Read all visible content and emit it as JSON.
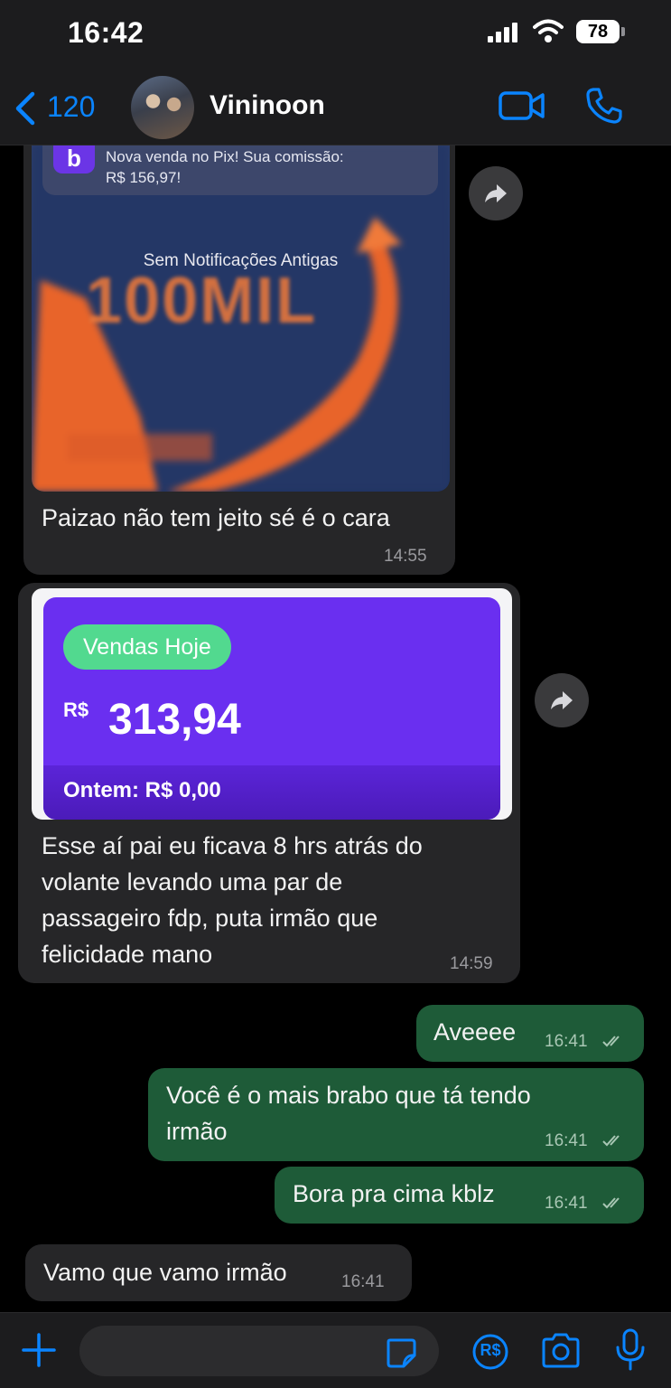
{
  "status_bar": {
    "time": "16:42",
    "battery": "78"
  },
  "header": {
    "back_count": "120",
    "contact_name": "Vininoon"
  },
  "colors": {
    "accent": "#0a84ff",
    "incoming_bubble": "#262628",
    "outgoing_bubble": "#1e5b38",
    "sales_purple": "#6a2ff0",
    "sales_green": "#52d98f"
  },
  "messages": [
    {
      "direction": "in",
      "image": {
        "notification_logo": "b",
        "notification_line1": "Nova venda no Pix! Sua comissão:",
        "notification_line2": "R$ 156,97!",
        "caption": "Sem Notificações Antigas",
        "banner": "100MIL"
      },
      "text": "Paizao não tem jeito sé é o cara",
      "time": "14:55"
    },
    {
      "direction": "in",
      "image": {
        "pill": "Vendas Hoje",
        "currency": "R$",
        "amount": "313,94",
        "yesterday": "Ontem: R$ 0,00"
      },
      "text_lines": [
        "Esse aí pai eu ficava 8 hrs atrás do",
        "volante levando uma par de",
        "passageiro fdp, puta irmão que",
        "felicidade mano"
      ],
      "time": "14:59"
    },
    {
      "direction": "out",
      "text": "Aveeee",
      "time": "16:41"
    },
    {
      "direction": "out",
      "text_lines": [
        "Você é o mais brabo que tá tendo",
        "irmão"
      ],
      "time": "16:41"
    },
    {
      "direction": "out",
      "text": "Bora pra cima kblz",
      "time": "16:41"
    },
    {
      "direction": "in",
      "text": "Vamo que vamo irmão",
      "time": "16:41"
    }
  ],
  "input_bar": {
    "placeholder": "",
    "value": "",
    "payment_icon": "R$"
  },
  "icons": [
    "back-chevron-icon",
    "video-call-icon",
    "phone-icon",
    "forward-icon",
    "plus-icon",
    "sticker-icon",
    "pix-payment-icon",
    "camera-icon",
    "microphone-icon"
  ]
}
